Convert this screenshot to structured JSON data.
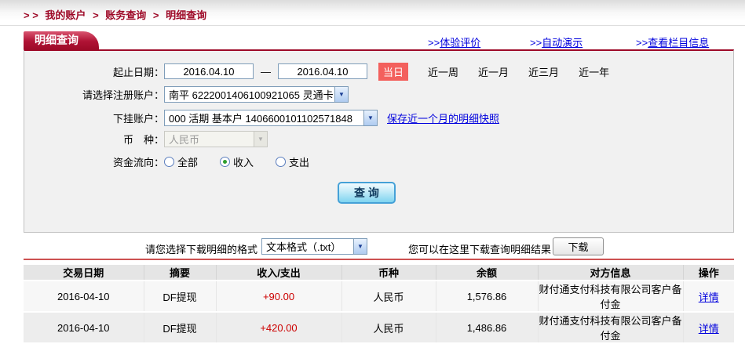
{
  "breadcrumb": {
    "prefix": "> >",
    "separator": ">",
    "items": [
      "我的账户",
      "账务查询",
      "明细查询"
    ]
  },
  "tab": {
    "title": "明细查询"
  },
  "header_links": [
    {
      "prefix": ">>",
      "label": "体验评价"
    },
    {
      "prefix": ">>",
      "label": "自动演示"
    },
    {
      "prefix": ">>",
      "label": "查看栏目信息"
    }
  ],
  "form": {
    "date_range": {
      "label": "起止日期：",
      "start": "2016.04.10",
      "separator": "—",
      "end": "2016.04.10",
      "quick_active": "当日",
      "quick_options": [
        "近一周",
        "近一月",
        "近三月",
        "近一年"
      ]
    },
    "register_account": {
      "label": "请选择注册账户：",
      "value": "南平 6222001406100921065 灵通卡"
    },
    "sub_account": {
      "label": "下挂账户：",
      "value": "000 活期 基本户 1406600101102571848",
      "snapshot_link": "保存近一个月的明细快照"
    },
    "currency": {
      "label": "币　种：",
      "value": "人民币"
    },
    "flow": {
      "label": "资金流向：",
      "options": [
        {
          "label": "全部",
          "checked": false
        },
        {
          "label": "收入",
          "checked": true
        },
        {
          "label": "支出",
          "checked": false
        }
      ]
    },
    "query_button": "查 询"
  },
  "download": {
    "format_label": "请您选择下载明细的格式",
    "format_value": "文本格式（.txt）",
    "hint": "您可以在这里下载查询明细结果",
    "button": "下载"
  },
  "table": {
    "headers": [
      "交易日期",
      "摘要",
      "收入/支出",
      "币种",
      "余额",
      "对方信息",
      "操作"
    ],
    "rows": [
      {
        "date": "2016-04-10",
        "summary": "DF提现",
        "amount": "+90.00",
        "currency": "人民币",
        "balance": "1,576.86",
        "counterparty": "财付通支付科技有限公司客户备付金",
        "action": "详情"
      },
      {
        "date": "2016-04-10",
        "summary": "DF提现",
        "amount": "+420.00",
        "currency": "人民币",
        "balance": "1,486.86",
        "counterparty": "财付通支付科技有限公司客户备付金",
        "action": "详情"
      }
    ]
  },
  "icons": {
    "dropdown_arrow": "▼"
  },
  "colors": {
    "brand_red": "#9e0a28",
    "badge_red": "#f3605d",
    "link_blue": "#0000dd",
    "amount_red": "#cc0000",
    "panel_bg": "#f1f1f1"
  }
}
